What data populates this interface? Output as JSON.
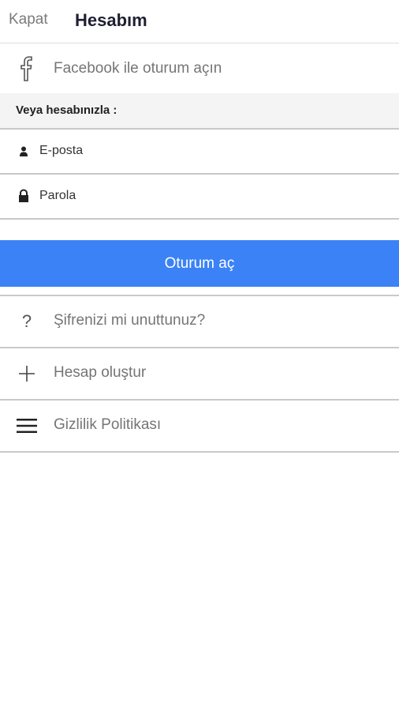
{
  "header": {
    "close_label": "Kapat",
    "title": "Hesabım"
  },
  "facebook": {
    "icon": "facebook-icon",
    "label": "Facebook ile oturum açın"
  },
  "subheading": "Veya hesabınızla :",
  "form": {
    "email_placeholder": "E-posta",
    "password_placeholder": "Parola"
  },
  "login_button": {
    "label": "Oturum aç",
    "color": "#3b82f6"
  },
  "menu": [
    {
      "icon": "question-icon",
      "label": "Şifrenizi mi unuttunuz?"
    },
    {
      "icon": "plus-icon",
      "label": "Hesap oluştur"
    },
    {
      "icon": "menu-icon",
      "label": "Gizlilik Politikası"
    }
  ]
}
